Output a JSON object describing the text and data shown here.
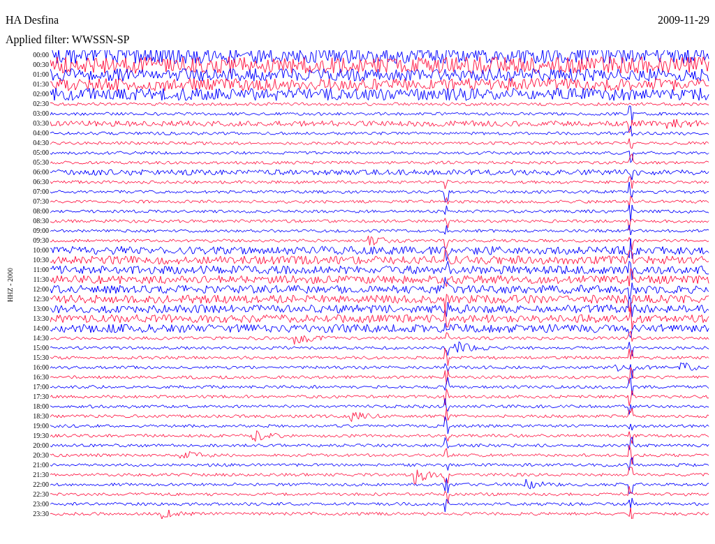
{
  "header": {
    "station": "HA Desfina",
    "date": "2009-11-29",
    "filter": "Applied filter: WWSSN-SP"
  },
  "plot": {
    "channel": "HHZ - 2000",
    "traces": [
      {
        "time": "00:00",
        "color": "#0000ff"
      },
      {
        "time": "00:30",
        "color": "#ff1744"
      },
      {
        "time": "01:00",
        "color": "#0000ff"
      },
      {
        "time": "01:30",
        "color": "#ff1744"
      },
      {
        "time": "02:00",
        "color": "#0000ff"
      },
      {
        "time": "02:30",
        "color": "#ff1744"
      },
      {
        "time": "03:00",
        "color": "#0000ff"
      },
      {
        "time": "03:30",
        "color": "#ff1744"
      },
      {
        "time": "04:00",
        "color": "#0000ff"
      },
      {
        "time": "04:30",
        "color": "#ff1744"
      },
      {
        "time": "05:00",
        "color": "#0000ff"
      },
      {
        "time": "05:30",
        "color": "#ff1744"
      },
      {
        "time": "06:00",
        "color": "#0000ff"
      },
      {
        "time": "06:30",
        "color": "#ff1744"
      },
      {
        "time": "07:00",
        "color": "#0000ff"
      },
      {
        "time": "07:30",
        "color": "#ff1744"
      },
      {
        "time": "08:00",
        "color": "#0000ff"
      },
      {
        "time": "08:30",
        "color": "#ff1744"
      },
      {
        "time": "09:00",
        "color": "#0000ff"
      },
      {
        "time": "09:30",
        "color": "#ff1744"
      },
      {
        "time": "10:00",
        "color": "#0000ff"
      },
      {
        "time": "10:30",
        "color": "#ff1744"
      },
      {
        "time": "11:00",
        "color": "#0000ff"
      },
      {
        "time": "11:30",
        "color": "#ff1744"
      },
      {
        "time": "12:00",
        "color": "#0000ff"
      },
      {
        "time": "12:30",
        "color": "#ff1744"
      },
      {
        "time": "13:00",
        "color": "#0000ff"
      },
      {
        "time": "13:30",
        "color": "#ff1744"
      },
      {
        "time": "14:00",
        "color": "#0000ff"
      },
      {
        "time": "14:30",
        "color": "#ff1744"
      },
      {
        "time": "15:00",
        "color": "#0000ff"
      },
      {
        "time": "15:30",
        "color": "#ff1744"
      },
      {
        "time": "16:00",
        "color": "#0000ff"
      },
      {
        "time": "16:30",
        "color": "#ff1744"
      },
      {
        "time": "17:00",
        "color": "#0000ff"
      },
      {
        "time": "17:30",
        "color": "#ff1744"
      },
      {
        "time": "18:00",
        "color": "#0000ff"
      },
      {
        "time": "18:30",
        "color": "#ff1744"
      },
      {
        "time": "19:00",
        "color": "#0000ff"
      },
      {
        "time": "19:30",
        "color": "#ff1744"
      },
      {
        "time": "20:00",
        "color": "#0000ff"
      },
      {
        "time": "20:30",
        "color": "#ff1744"
      },
      {
        "time": "21:00",
        "color": "#0000ff"
      },
      {
        "time": "21:30",
        "color": "#ff1744"
      },
      {
        "time": "22:00",
        "color": "#0000ff"
      },
      {
        "time": "22:30",
        "color": "#ff1744"
      },
      {
        "time": "23:00",
        "color": "#0000ff"
      },
      {
        "time": "23:30",
        "color": "#ff1744"
      }
    ]
  }
}
